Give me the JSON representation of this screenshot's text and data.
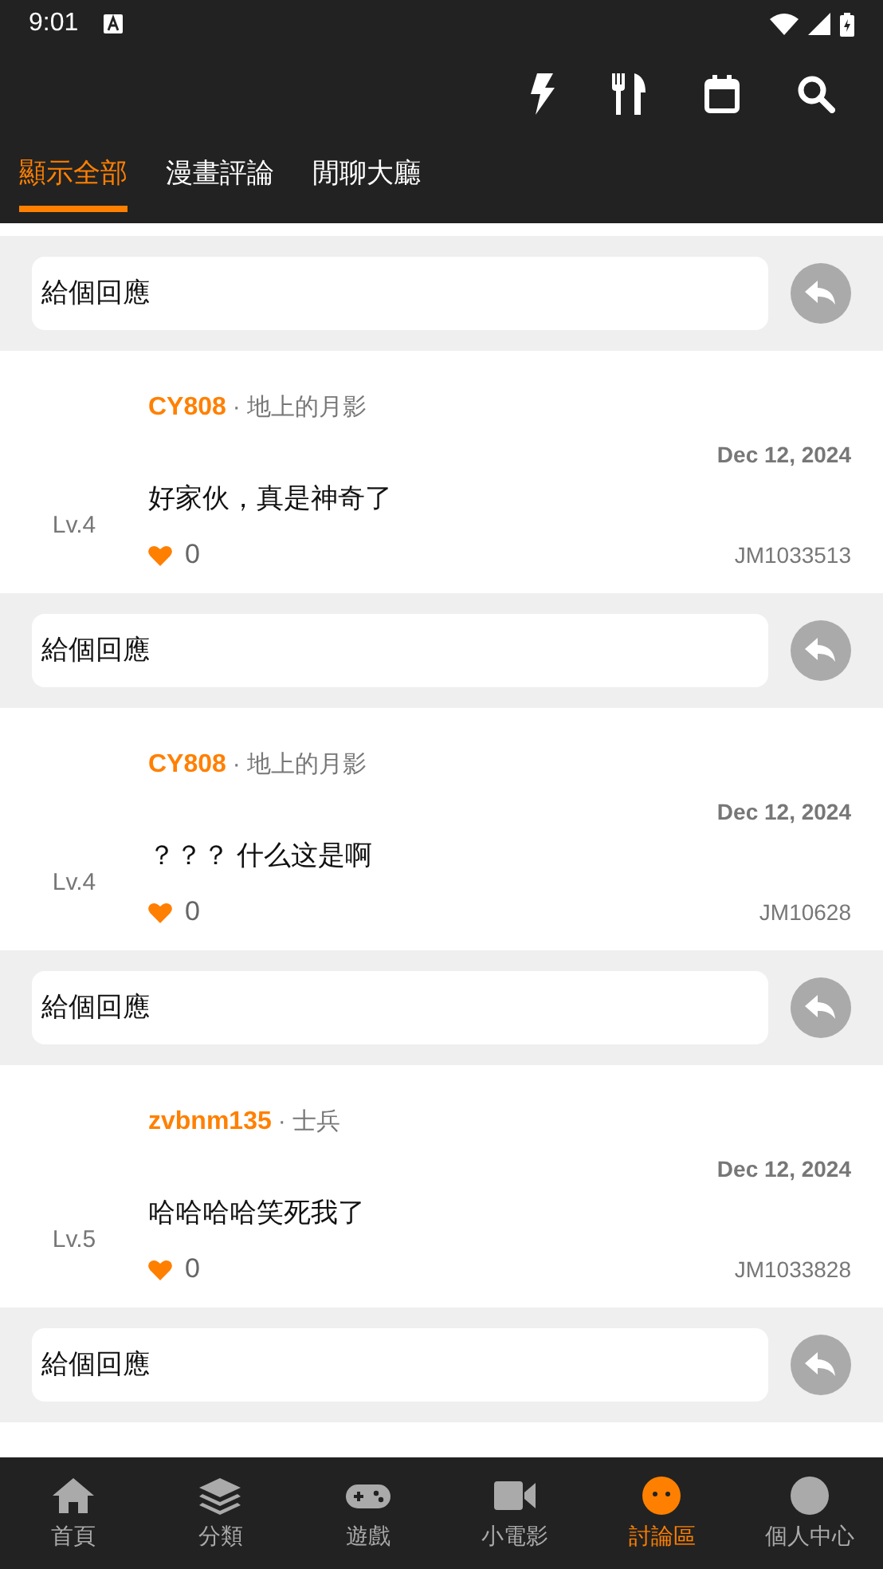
{
  "status_bar": {
    "time": "9:01"
  },
  "tabs": [
    {
      "label": "顯示全部",
      "selected": true
    },
    {
      "label": "漫畫評論",
      "selected": false
    },
    {
      "label": "閒聊大廳",
      "selected": false
    }
  ],
  "feed": [
    {
      "kind": "reply",
      "placeholder": "給個回應"
    },
    {
      "kind": "comment",
      "user": "CY808",
      "title": "· 地上的月影",
      "date": "Dec 12, 2024",
      "text": "好家伙，真是神奇了",
      "level": "Lv.4",
      "likes": "0",
      "ref": "JM1033513"
    },
    {
      "kind": "reply",
      "placeholder": "給個回應"
    },
    {
      "kind": "comment",
      "user": "CY808",
      "title": "· 地上的月影",
      "date": "Dec 12, 2024",
      "text": "？？？ 什么这是啊",
      "level": "Lv.4",
      "likes": "0",
      "ref": "JM10628"
    },
    {
      "kind": "reply",
      "placeholder": "給個回應"
    },
    {
      "kind": "comment",
      "user": "zvbnm135",
      "title": "· 士兵",
      "date": "Dec 12, 2024",
      "text": "哈哈哈哈笑死我了",
      "level": "Lv.5",
      "likes": "0",
      "ref": "JM1033828"
    },
    {
      "kind": "reply",
      "placeholder": "給個回應"
    }
  ],
  "bottom_nav": [
    {
      "label": "首頁",
      "selected": false
    },
    {
      "label": "分類",
      "selected": false
    },
    {
      "label": "遊戲",
      "selected": false
    },
    {
      "label": "小電影",
      "selected": false
    },
    {
      "label": "討論區",
      "selected": true
    },
    {
      "label": "個人中心",
      "selected": false
    }
  ]
}
